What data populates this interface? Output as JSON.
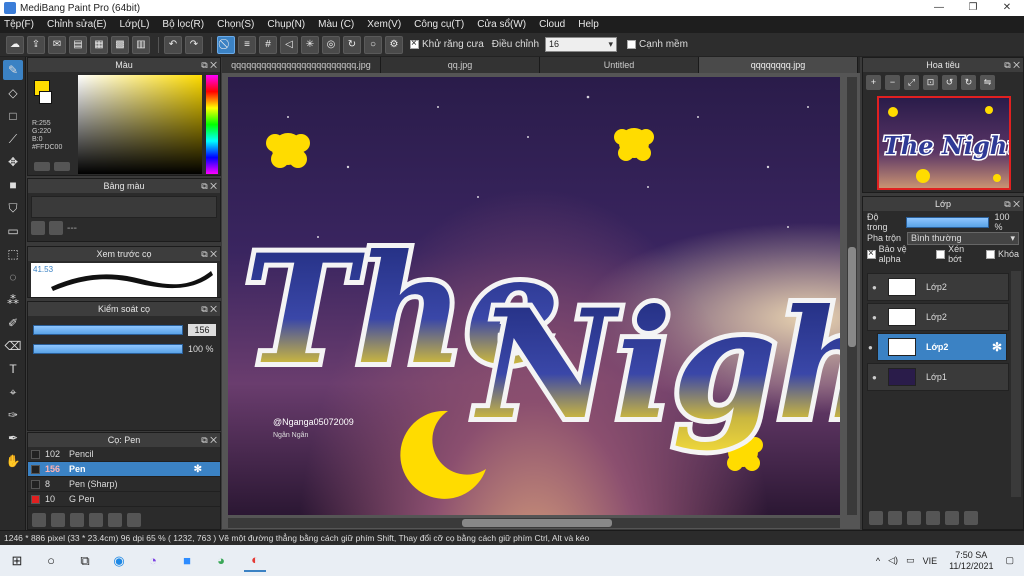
{
  "window": {
    "title": "MediBang Paint Pro (64bit)",
    "minimize": "—",
    "restore": "❐",
    "close": "✕"
  },
  "menu": [
    "Tệp(F)",
    "Chỉnh sửa(E)",
    "Lớp(L)",
    "Bộ lọc(R)",
    "Chọn(S)",
    "Chụp(N)",
    "Màu (C)",
    "Xem(V)",
    "Công cụ(T)",
    "Cửa sổ(W)",
    "Cloud",
    "Help"
  ],
  "toolbar": {
    "antialias_label": "Khử răng cưa",
    "adjust_label": "Điều chỉnh",
    "adjust_value": "16",
    "smooth_label": "Cạnh mềm"
  },
  "color_panel": {
    "title": "Màu",
    "r": "R:255",
    "g": "G:220",
    "b": "B:0",
    "hex": "#FFDC00",
    "fg": "#FFDC00"
  },
  "palette_panel": {
    "title": "Bảng màu",
    "dash": "---"
  },
  "preview_panel": {
    "title": "Xem trước cọ",
    "size": "41.53"
  },
  "control_panel": {
    "title": "Kiểm soát cọ",
    "size_value": "156",
    "opacity_value": "100 %"
  },
  "brush_panel": {
    "title": "Cọ: Pen",
    "brushes": [
      {
        "size": "102",
        "name": "Pencil"
      },
      {
        "size": "156",
        "name": "Pen"
      },
      {
        "size": "8",
        "name": "Pen (Sharp)"
      },
      {
        "size": "10",
        "name": "G Pen"
      }
    ]
  },
  "tabs": [
    "qqqqqqqqqqqqqqqqqqqqqqqqq.jpg",
    "qq.jpg",
    "Untitled",
    "qqqqqqqq.jpg"
  ],
  "artwork": {
    "title_line1": "The",
    "title_line2": "Nights",
    "signature": "@Nganga05072009",
    "signature2": "Ngân Ngân"
  },
  "navigator": {
    "title": "Hoa tiêu",
    "thumb_text": "The Nights"
  },
  "layer_panel": {
    "title": "Lớp",
    "opacity_label": "Độ trong",
    "opacity_value": "100 %",
    "blend_label": "Pha trộn",
    "blend_value": "Bình thường",
    "protect_alpha": "Bảo vệ alpha",
    "clipping": "Xén bớt",
    "lock": "Khóa",
    "layers": [
      "Lớp2",
      "Lớp2",
      "Lớp2",
      "Lớp1"
    ]
  },
  "status": {
    "size": "1246 * 886 pixel",
    "cm": "(33 * 23.4cm)",
    "dpi": "96 dpi",
    "zoom": "65 %",
    "coords": "( 1232, 763 )",
    "hint": "Vẽ một đường thẳng bằng cách giữ phím Shift, Thay đổi cỡ cọ bằng cách giữ phím Ctrl, Alt và kéo"
  },
  "taskbar": {
    "lang": "VIE",
    "time": "7:50 SA",
    "date": "11/12/2021"
  }
}
